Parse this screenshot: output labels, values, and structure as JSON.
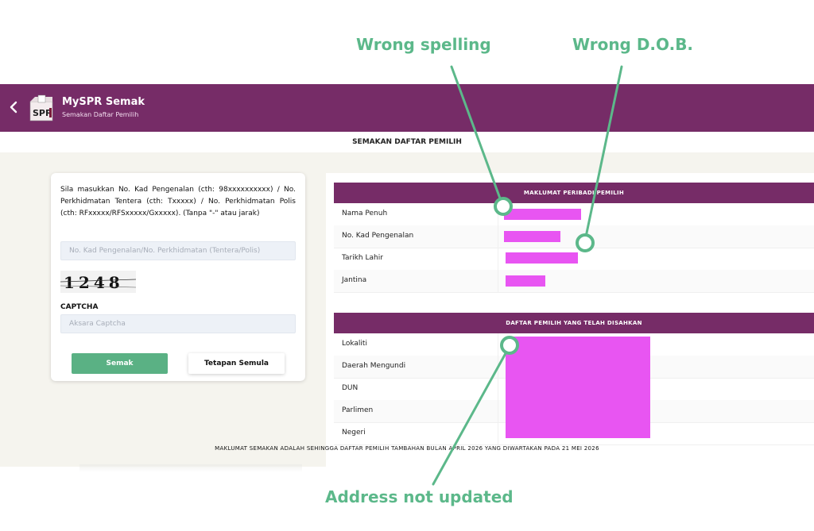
{
  "annotations": {
    "wrong_spelling": "Wrong spelling",
    "wrong_dob": "Wrong D.O.B.",
    "address_not_updated": "Address not updated"
  },
  "header": {
    "back_icon": "chevron-left-icon",
    "logo_text": "SPR",
    "title": "MySPR Semak",
    "subtitle": "Semakan Daftar Pemilih"
  },
  "subheader": {
    "title": "SEMAKAN DAFTAR PEMILIH"
  },
  "form": {
    "instruction": "Sila masukkan No. Kad Pengenalan (cth: 98xxxxxxxxxx) / No. Perkhidmatan Tentera (cth: Txxxxx) / No. Perkhidmatan Polis (cth: RFxxxxx/RFSxxxxx/Gxxxxx). (Tanpa \"-\" atau jarak)",
    "id_placeholder": "No. Kad Pengenalan/No. Perkhidmatan (Tentera/Polis)",
    "captcha_text": "1248",
    "captcha_label": "CAPTCHA",
    "captcha_placeholder": "Aksara Captcha",
    "submit_label": "Semak",
    "reset_label": "Tetapan Semula"
  },
  "personal": {
    "heading": "MAKLUMAT PERIBADI PEMILIH",
    "rows": [
      {
        "label": "Nama Penuh"
      },
      {
        "label": "No. Kad Pengenalan"
      },
      {
        "label": "Tarikh Lahir"
      },
      {
        "label": "Jantina"
      }
    ]
  },
  "voter": {
    "heading": "DAFTAR PEMILIH YANG TELAH DISAHKAN",
    "rows": [
      {
        "label": "Lokaliti"
      },
      {
        "label": "Daerah Mengundi"
      },
      {
        "label": "DUN"
      },
      {
        "label": "Parlimen"
      },
      {
        "label": "Negeri"
      }
    ]
  },
  "footer_note": "MAKLUMAT SEMAKAN ADALAH SEHINGGA DAFTAR PEMILIH TAMBAHAN BULAN APRIL 2026 YANG DIWARTAKAN PADA 21 MEI 2026",
  "colors": {
    "header": "#762c67",
    "accent_green": "#5ab184",
    "annotation_green": "#5cb88a",
    "redaction": "#e855f2"
  }
}
